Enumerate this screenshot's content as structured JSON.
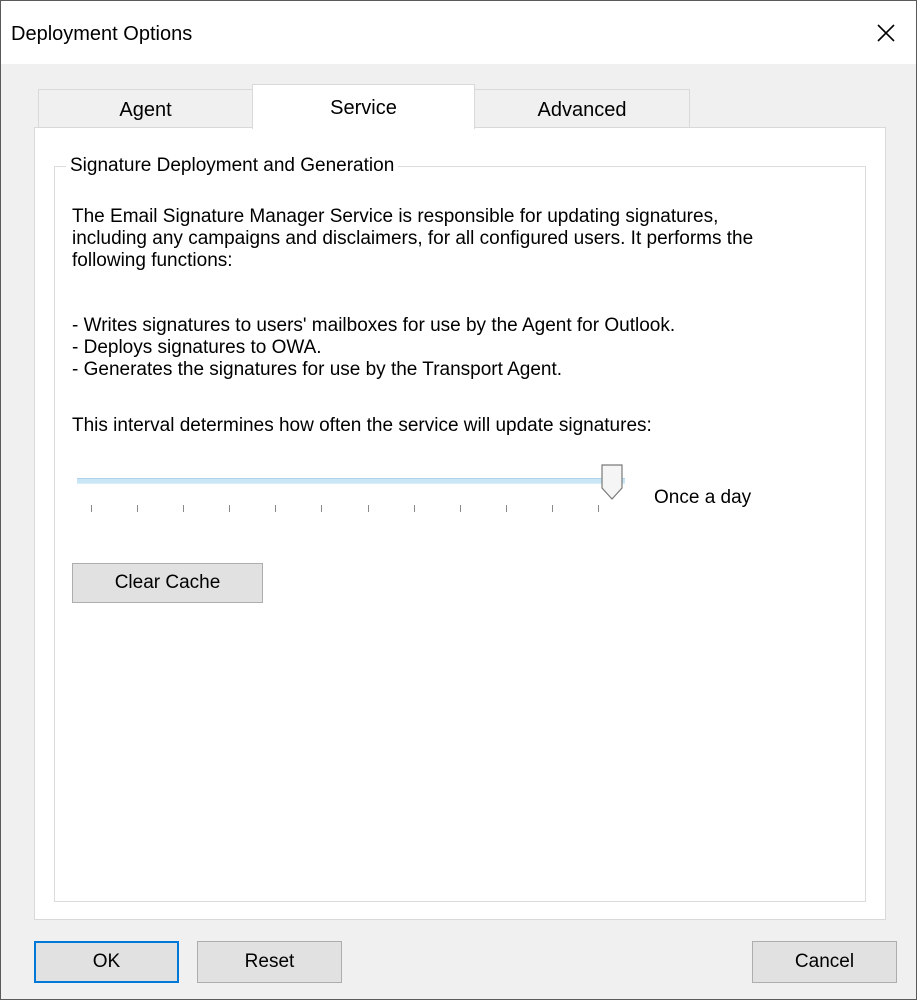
{
  "window": {
    "title": "Deployment Options",
    "close_icon": "close-icon"
  },
  "tabs": [
    {
      "label": "Agent",
      "active": false
    },
    {
      "label": "Service",
      "active": true
    },
    {
      "label": "Advanced",
      "active": false
    }
  ],
  "group": {
    "legend": "Signature Deployment and Generation",
    "description_lines": [
      "The Email Signature Manager Service is responsible for updating signatures,",
      "including any campaigns and disclaimers, for all configured users. It performs the",
      "following functions:"
    ],
    "bullets": [
      "- Writes signatures to users' mailboxes for use by the Agent for Outlook.",
      "- Deploys signatures to OWA.",
      "- Generates the signatures for use by the Transport Agent."
    ],
    "interval_label": "This interval determines how often the service will update signatures:",
    "slider": {
      "value_label": "Once a day",
      "position_fraction": 1.0,
      "tick_count": 12
    },
    "clear_cache_label": "Clear Cache"
  },
  "footer": {
    "ok_label": "OK",
    "reset_label": "Reset",
    "cancel_label": "Cancel"
  },
  "colors": {
    "accent": "#0078d7",
    "slider_track": "#c8e6f5"
  }
}
